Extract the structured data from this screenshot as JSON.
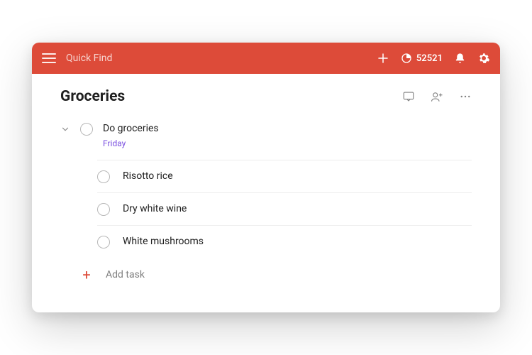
{
  "colors": {
    "accent": "#DD4B39",
    "date": "#7a4fe0"
  },
  "topbar": {
    "quick_find_placeholder": "Quick Find",
    "karma_count": "52521"
  },
  "list": {
    "title": "Groceries",
    "main_task": {
      "title": "Do groceries",
      "date": "Friday"
    },
    "subtasks": [
      {
        "title": "Risotto rice"
      },
      {
        "title": "Dry white wine"
      },
      {
        "title": "White mushrooms"
      }
    ],
    "add_task_label": "Add task"
  }
}
